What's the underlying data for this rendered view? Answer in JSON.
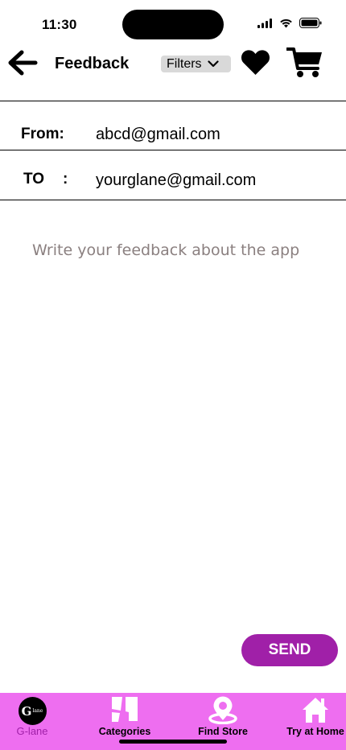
{
  "status_bar": {
    "time": "11:30"
  },
  "header": {
    "title": "Feedback",
    "filters_label": "Filters"
  },
  "email": {
    "from_label": "From:",
    "from_value": "abcd@gmail.com",
    "to_label": "TO",
    "to_colon": ":",
    "to_value": "yourglane@gmail.com"
  },
  "feedback": {
    "placeholder": "Write your feedback about the app"
  },
  "send_label": "SEND",
  "bottom_nav": {
    "items": [
      {
        "label": "G-lane",
        "icon": "glane-logo-icon"
      },
      {
        "label": "Categories",
        "icon": "categories-icon"
      },
      {
        "label": "Find Store",
        "icon": "location-pin-icon"
      },
      {
        "label": "Try at Home",
        "icon": "home-icon"
      }
    ]
  },
  "colors": {
    "accent": "#a020a8",
    "nav_background": "#ee6ef0",
    "filters_background": "#d9d9d9",
    "placeholder": "#8b8080"
  }
}
